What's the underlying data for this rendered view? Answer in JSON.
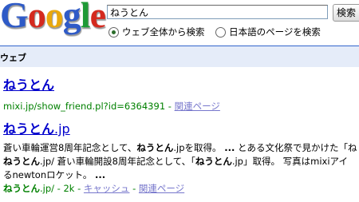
{
  "logo": {
    "letters": [
      "G",
      "o",
      "o",
      "g",
      "l",
      "e"
    ],
    "colors": [
      "#2f5bc7",
      "#d42a1f",
      "#e9a80d",
      "#2f5bc7",
      "#1e9a36",
      "#d42a1f"
    ]
  },
  "search": {
    "value": "ねうとん",
    "button_label": "検索"
  },
  "radios": [
    {
      "label": "ウェブ全体から検索",
      "selected": true
    },
    {
      "label": "日本語のページを検索",
      "selected": false
    }
  ],
  "bar": {
    "label": "ウェブ"
  },
  "results": [
    {
      "title": "ねうとん",
      "url": "mixi.jp/show_friend.pl?id=6364391",
      "sep": " - ",
      "related": "関連ページ"
    },
    {
      "title_bold": "ねうとん",
      "title_rest": ".jp",
      "snippet1_a": "蒼い車輪運営8周年記念として、",
      "snippet1_b": "ねうとん",
      "snippet1_c": ".jpを取得。 ",
      "snippet1_d": "...",
      "snippet1_e": " とある文化祭で見かけた「ね",
      "snippet2_a": "ねうとん",
      "snippet2_b": ".jp/ 蒼い車輪開設8周年記念として、「",
      "snippet2_c": "ねうとん",
      "snippet2_d": ".jp」取得。 写真はmixiアイ",
      "snippet3_a": "るnewtonロケット。 ",
      "snippet3_b": "...",
      "url_bold": "ねうとん",
      "url_rest": ".jp/ - 2k - ",
      "cache": "キャッシュ",
      "sep": " - ",
      "related": "関連ページ"
    }
  ]
}
